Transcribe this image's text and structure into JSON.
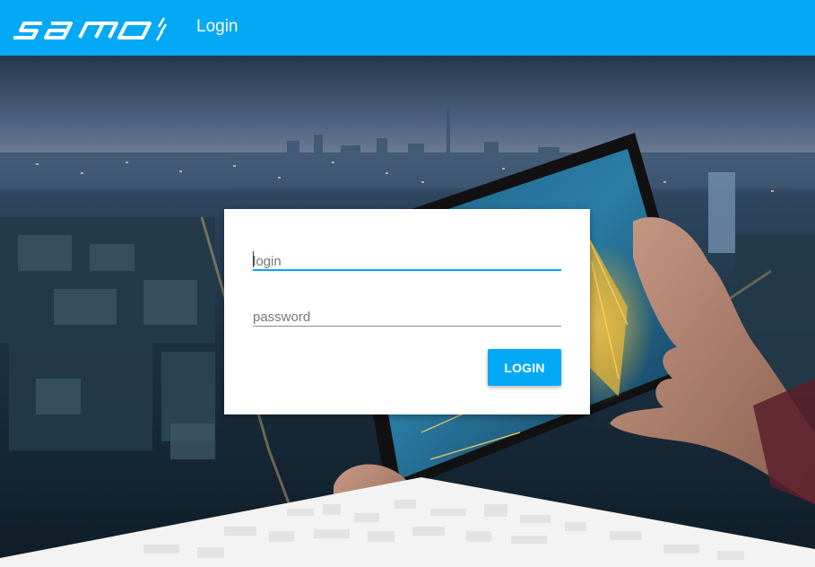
{
  "header": {
    "logo_text": "samo",
    "title": "Login"
  },
  "form": {
    "login_placeholder": "login",
    "login_value": "",
    "password_placeholder": "password",
    "password_value": "",
    "submit_label": "LOGIN"
  },
  "colors": {
    "accent": "#03a9f4",
    "card": "#ffffff"
  },
  "icons": {
    "logo": "samo-logo-icon",
    "background": "city-tablet-background-image"
  }
}
